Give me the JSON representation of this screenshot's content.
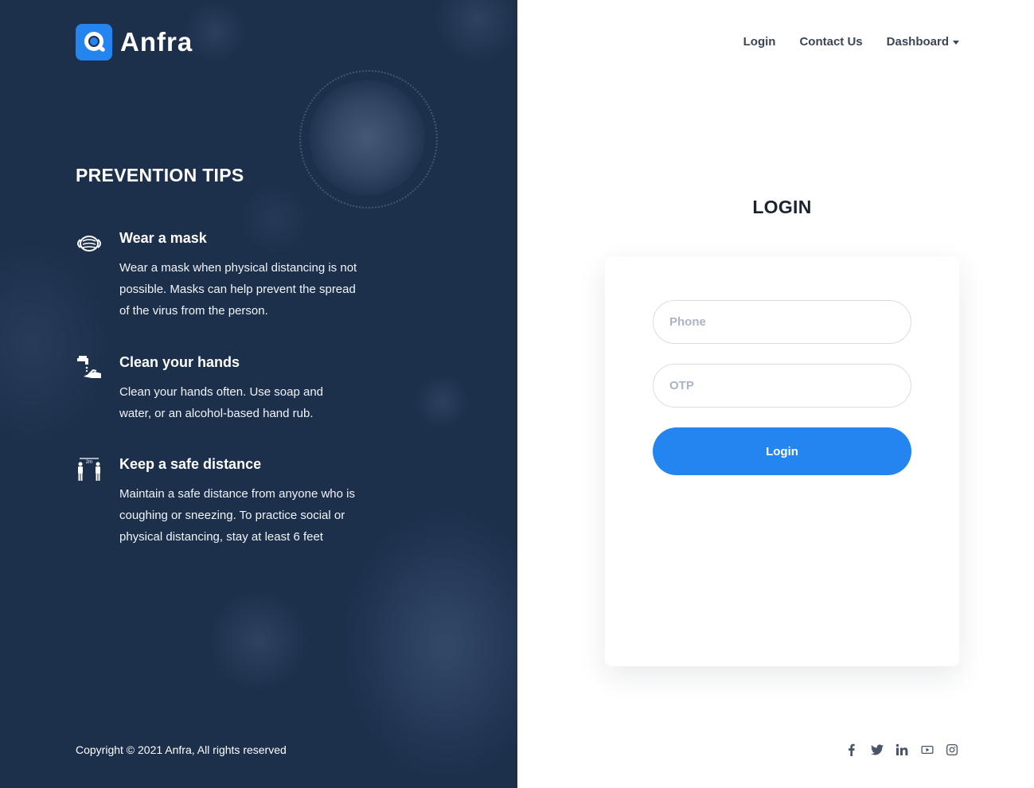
{
  "brand": {
    "name": "Anfra",
    "accent": "#2484f0",
    "logo_icon": "search-logo-icon"
  },
  "left_panel": {
    "background": "#1c2f4b",
    "tips_title": "PREVENTION TIPS",
    "tips": [
      {
        "icon": "mask-icon",
        "title": "Wear a mask",
        "text": "Wear a mask when physical distancing is not possible. Masks can help prevent the spread of the virus from the person."
      },
      {
        "icon": "hand-wash-icon",
        "title": "Clean your hands",
        "text": "Clean your hands often. Use soap and water, or an alcohol-based hand rub."
      },
      {
        "icon": "safe-distance-icon",
        "title": "Keep a safe distance",
        "text": "Maintain a safe distance from anyone who is coughing or sneezing. To practice social or physical distancing, stay at least 6 feet"
      }
    ],
    "copyright": "Copyright © 2021 Anfra, All rights reserved"
  },
  "nav": {
    "items": [
      {
        "label": "Login"
      },
      {
        "label": "Contact Us"
      },
      {
        "label": "Dashboard",
        "has_dropdown": true
      }
    ]
  },
  "login": {
    "title": "LOGIN",
    "phone_placeholder": "Phone",
    "phone_value": "",
    "otp_placeholder": "OTP",
    "otp_value": "",
    "button_label": "Login"
  },
  "social": [
    "facebook-icon",
    "twitter-icon",
    "linkedin-icon",
    "youtube-icon",
    "instagram-icon"
  ]
}
